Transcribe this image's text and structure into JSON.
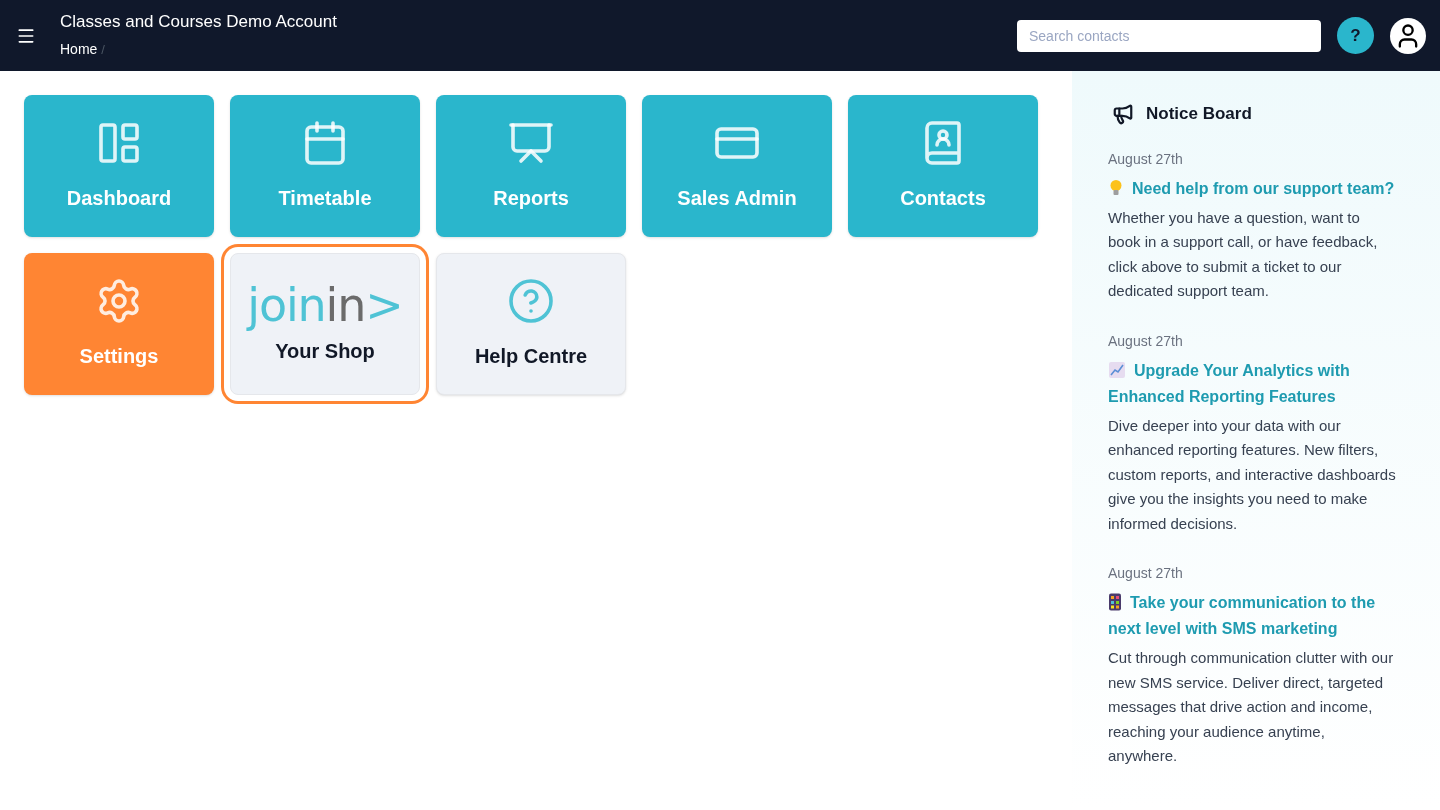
{
  "header": {
    "title": "Classes and Courses Demo Account",
    "breadcrumb": [
      {
        "label": "Home",
        "separator": "/"
      }
    ],
    "search": {
      "placeholder": "Search contacts"
    },
    "help_button": "?"
  },
  "tiles": [
    {
      "kind": "primary",
      "label": "Dashboard",
      "highlighted": false
    },
    {
      "kind": "primary",
      "label": "Timetable",
      "highlighted": false
    },
    {
      "kind": "primary",
      "label": "Reports",
      "highlighted": false
    },
    {
      "kind": "primary",
      "label": "Sales Admin",
      "highlighted": false
    },
    {
      "kind": "primary",
      "label": "Contacts",
      "highlighted": false
    },
    {
      "kind": "accent",
      "label": "Settings",
      "highlighted": false
    },
    {
      "kind": "logo",
      "logo": [
        {
          "text": "join",
          "color": "#4fc3d5"
        },
        {
          "text": "in",
          "color": "#6b6b6b"
        },
        {
          "text": ">",
          "color": "#4fc3d5"
        }
      ],
      "label": "Your Shop",
      "highlighted": true
    },
    {
      "kind": "plain",
      "label": "Help Centre",
      "highlighted": false
    }
  ],
  "notice_board": {
    "title": "Notice Board",
    "notices": [
      {
        "date": "August 27th",
        "title": "Need help from our support team?",
        "body": "Whether you have a question, want to book in a support call, or have feedback, click above to submit a ticket to our dedicated support team."
      },
      {
        "date": "August 27th",
        "title": "Upgrade Your Analytics with Enhanced Reporting Features",
        "body": "Dive deeper into your data with our enhanced reporting features. New filters, custom reports, and interactive dashboards give you the insights you need to make informed decisions."
      },
      {
        "date": "August 27th",
        "title": "Take your communication to the next level with SMS marketing",
        "body": "Cut through communication clutter with our new SMS service. Deliver direct, targeted messages that drive action and income, reaching your audience anytime, anywhere."
      }
    ]
  }
}
